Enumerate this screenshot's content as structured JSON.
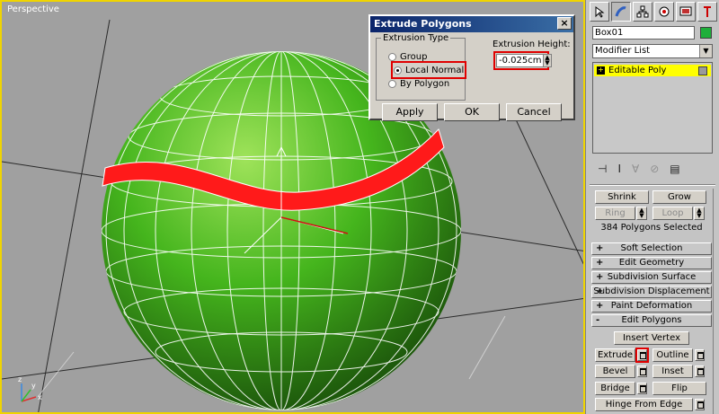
{
  "viewport": {
    "label": "Perspective",
    "axis_x": "x",
    "axis_y": "y",
    "axis_z": "z"
  },
  "dialog": {
    "title": "Extrude Polygons",
    "close": "×",
    "extrusion_type_label": "Extrusion Type",
    "options": [
      "Group",
      "Local Normal",
      "By Polygon"
    ],
    "selected_option": "Local Normal",
    "height_label": "Extrusion Height:",
    "height_value": "-0.025cm",
    "buttons": {
      "apply": "Apply",
      "ok": "OK",
      "cancel": "Cancel"
    }
  },
  "panel": {
    "tab_icons": [
      "create-icon",
      "modify-icon",
      "hierarchy-icon",
      "motion-icon",
      "display-icon",
      "utilities-icon"
    ],
    "object_name": "Box01",
    "object_color": "#1eaf3a",
    "modifier_list": "Modifier List",
    "stack_item": "Editable Poly",
    "buttons": {
      "shrink": "Shrink",
      "grow": "Grow",
      "ring": "Ring",
      "loop": "Loop"
    },
    "selection_status": "384 Polygons Selected",
    "rollouts": [
      {
        "sign": "+",
        "label": "Soft Selection"
      },
      {
        "sign": "+",
        "label": "Edit Geometry"
      },
      {
        "sign": "+",
        "label": "Subdivision Surface"
      },
      {
        "sign": "+",
        "label": "Subdivision Displacement"
      },
      {
        "sign": "+",
        "label": "Paint Deformation"
      },
      {
        "sign": "-",
        "label": "Edit Polygons"
      }
    ],
    "edit_polygons": {
      "insert_vertex": "Insert Vertex",
      "extrude": "Extrude",
      "outline": "Outline",
      "bevel": "Bevel",
      "inset": "Inset",
      "bridge": "Bridge",
      "flip": "Flip",
      "hinge_from_edge": "Hinge From Edge"
    }
  },
  "colors": {
    "highlight": "#e00000",
    "sphere": "#3cb81a",
    "stripe": "#ff0000",
    "active_border": "#f0d400",
    "stack_selected": "#ffff00"
  }
}
